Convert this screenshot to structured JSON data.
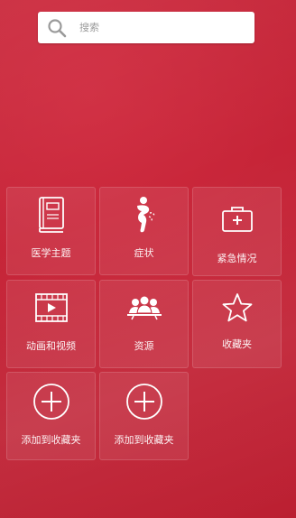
{
  "search": {
    "placeholder": "搜索"
  },
  "tiles": [
    {
      "label": "医学主题",
      "icon": "book-icon"
    },
    {
      "label": "症状",
      "icon": "symptom-body-icon"
    },
    {
      "label": "紧急情况",
      "icon": "first-aid-kit-icon"
    },
    {
      "label": "动画和视频",
      "icon": "video-film-icon"
    },
    {
      "label": "资源",
      "icon": "people-group-icon"
    },
    {
      "label": "收藏夹",
      "icon": "star-icon"
    },
    {
      "label": "添加到收藏夹",
      "icon": "plus-circle-icon"
    },
    {
      "label": "添加到收藏夹",
      "icon": "plus-circle-icon"
    }
  ],
  "colors": {
    "background": "#c32235",
    "icon_stroke": "#ffffff",
    "search_bg": "#ffffff"
  }
}
